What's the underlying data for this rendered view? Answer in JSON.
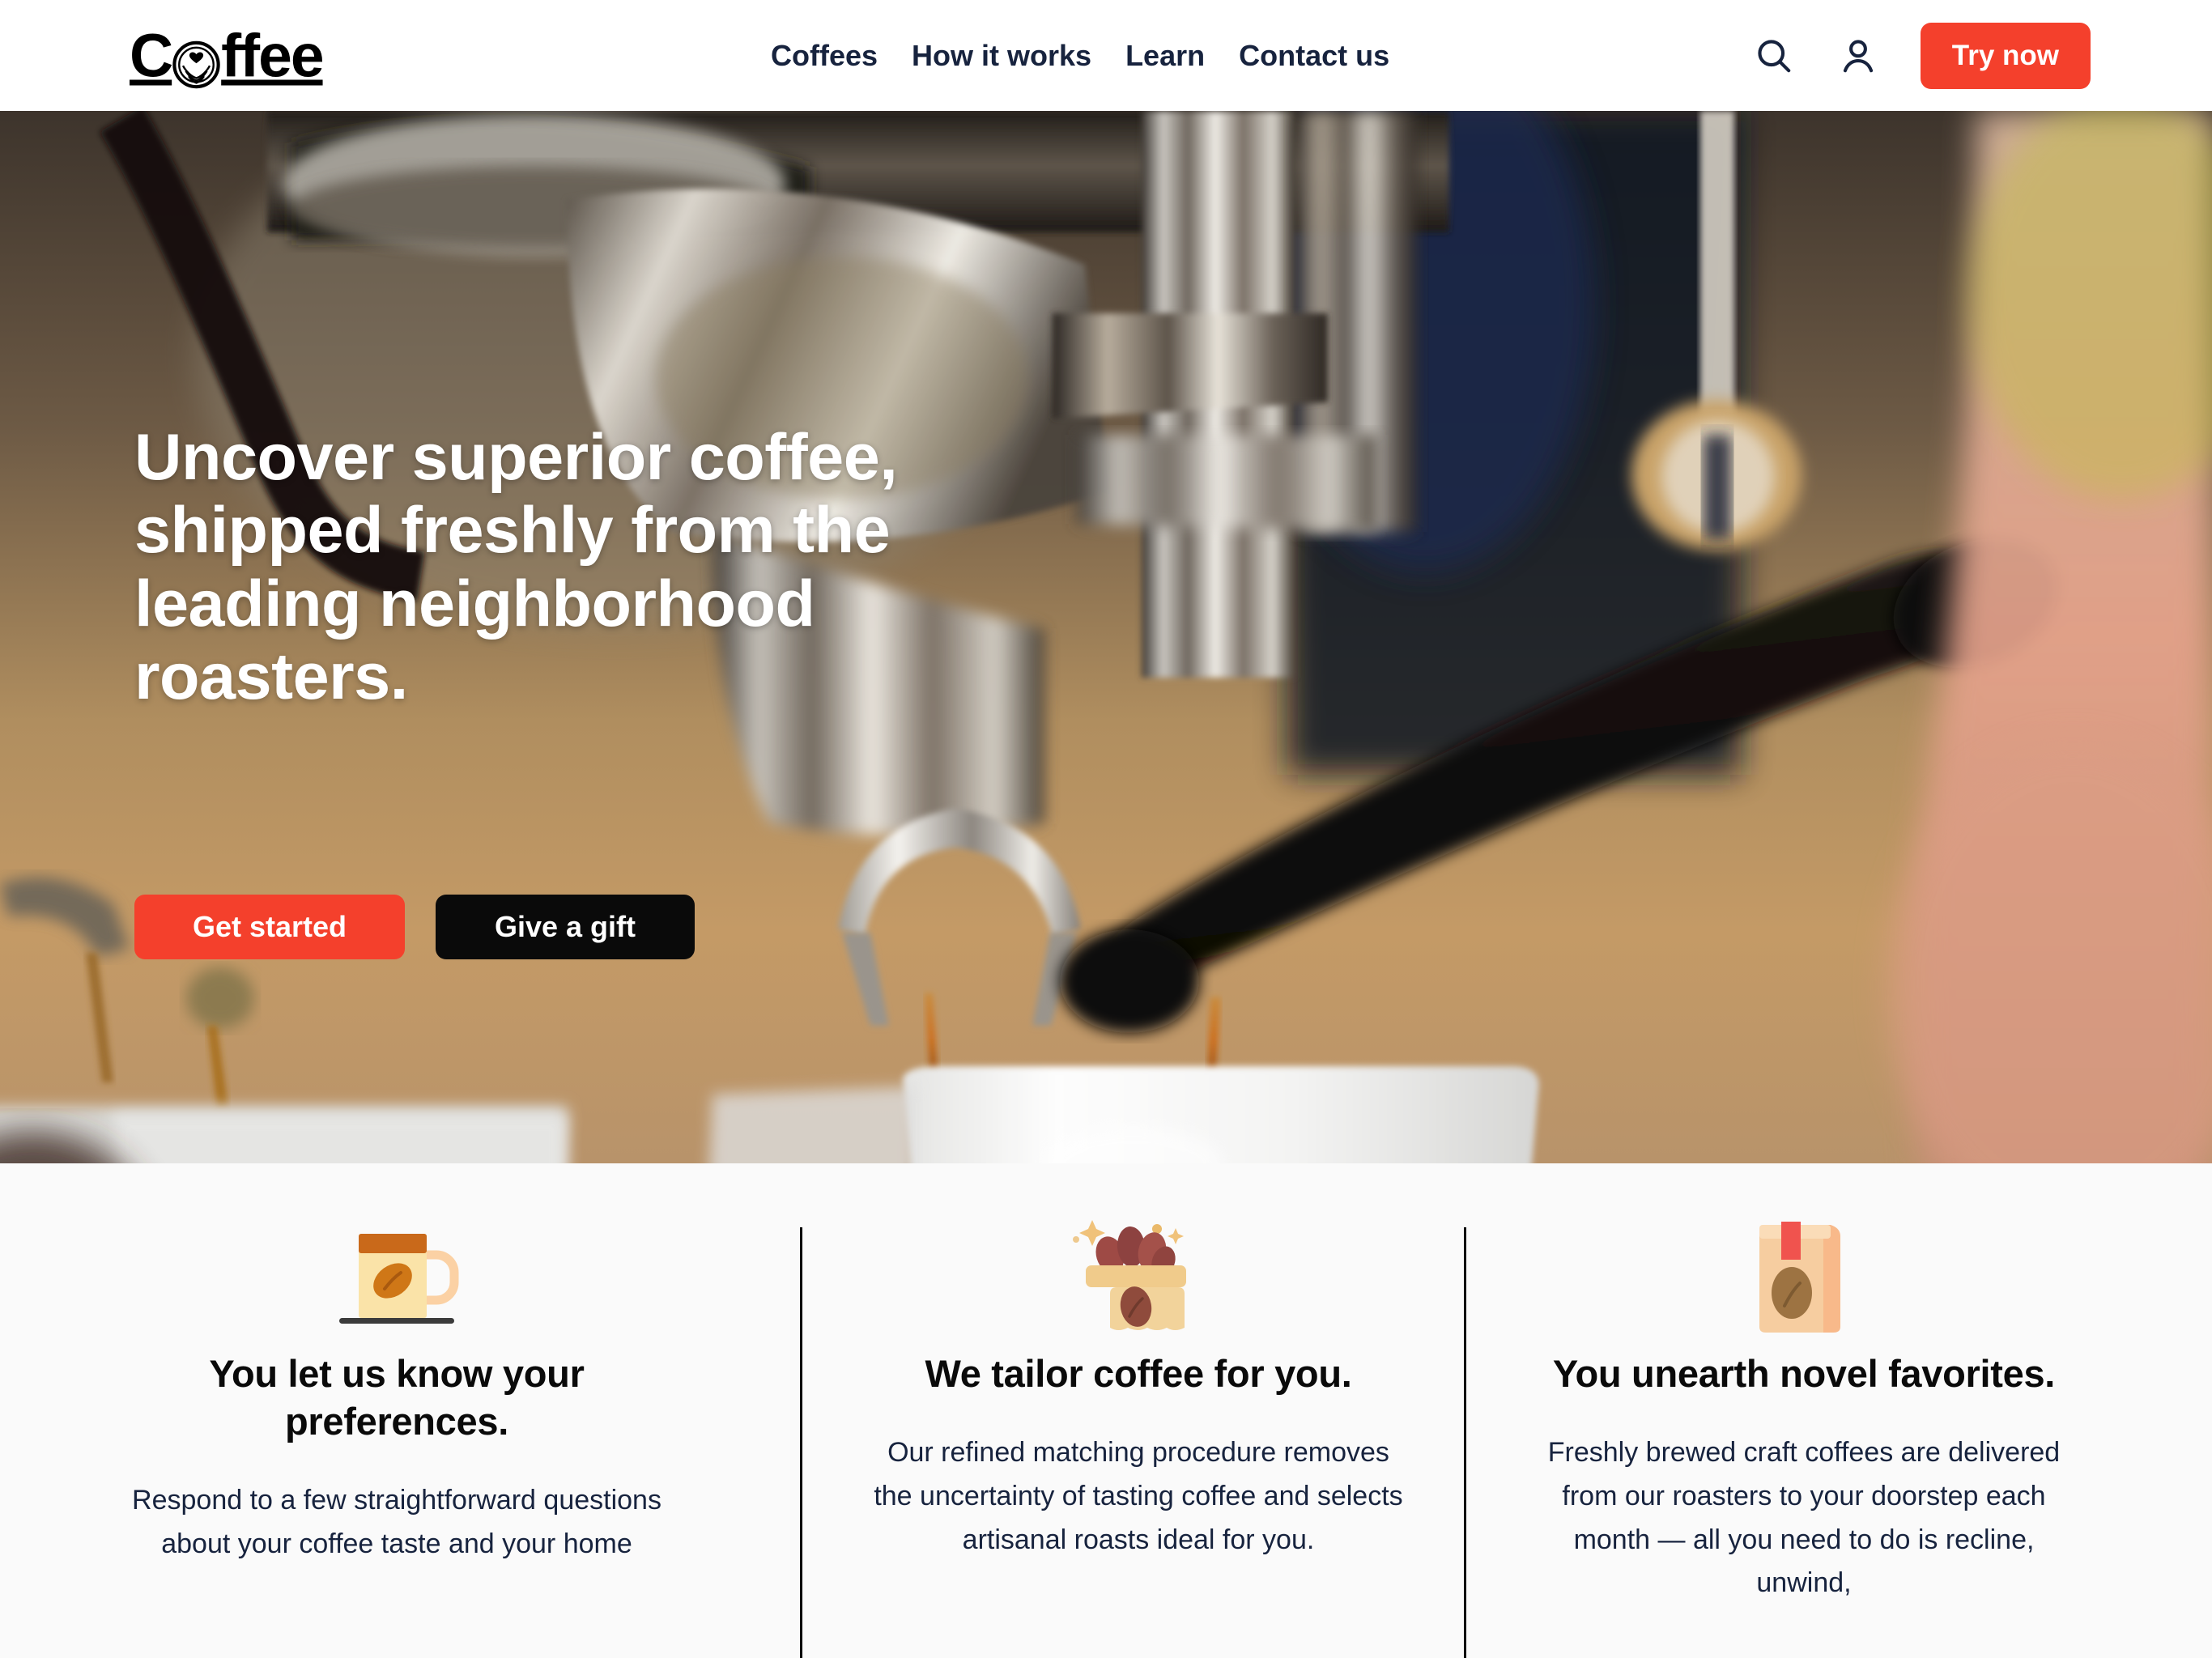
{
  "brand": {
    "name": "Coffee",
    "logo_prefix": "C",
    "logo_suffix": "ffee",
    "logo_mark_icon": "latte-art-circle-icon"
  },
  "colors": {
    "accent_red": "#f4402c",
    "nav_text": "#17233e",
    "hero_text": "#ffffff",
    "black_button": "#0a0a0a",
    "section_bg": "#fafafa",
    "divider": "#000000"
  },
  "header": {
    "nav": [
      {
        "label": "Coffees",
        "name": "nav-link-coffees"
      },
      {
        "label": "How it works",
        "name": "nav-link-how-it-works"
      },
      {
        "label": "Learn",
        "name": "nav-link-learn"
      },
      {
        "label": "Contact us",
        "name": "nav-link-contact-us"
      }
    ],
    "search_icon": "search-icon",
    "account_icon": "user-account-icon",
    "cta_label": "Try now"
  },
  "hero": {
    "title": "Uncover superior coffee, shipped freshly from the leading neighborhood roasters.",
    "title_lines": [
      "Uncover superior coffee,",
      "shipped freshly from the",
      "leading neighborhood",
      "roasters."
    ],
    "primary_button": "Get started",
    "secondary_button": "Give a gift",
    "background_image_description": "Close-up of a chrome espresso machine portafilter pouring two streams of espresso into a white cup"
  },
  "features": [
    {
      "icon": "coffee-mug-with-bean-icon",
      "title": "You let us know your preferences.",
      "body": "Respond to a few straightforward questions about your coffee taste and your home"
    },
    {
      "icon": "coffee-bean-sack-icon",
      "title": "We tailor coffee for you.",
      "body": "Our refined matching procedure removes the uncertainty of tasting coffee and selects artisanal roasts ideal for you."
    },
    {
      "icon": "coffee-bag-icon",
      "title": "You unearth novel favorites.",
      "body": "Freshly brewed craft coffees are delivered from our roasters to your doorstep each month — all you need to do is recline, unwind,"
    }
  ]
}
